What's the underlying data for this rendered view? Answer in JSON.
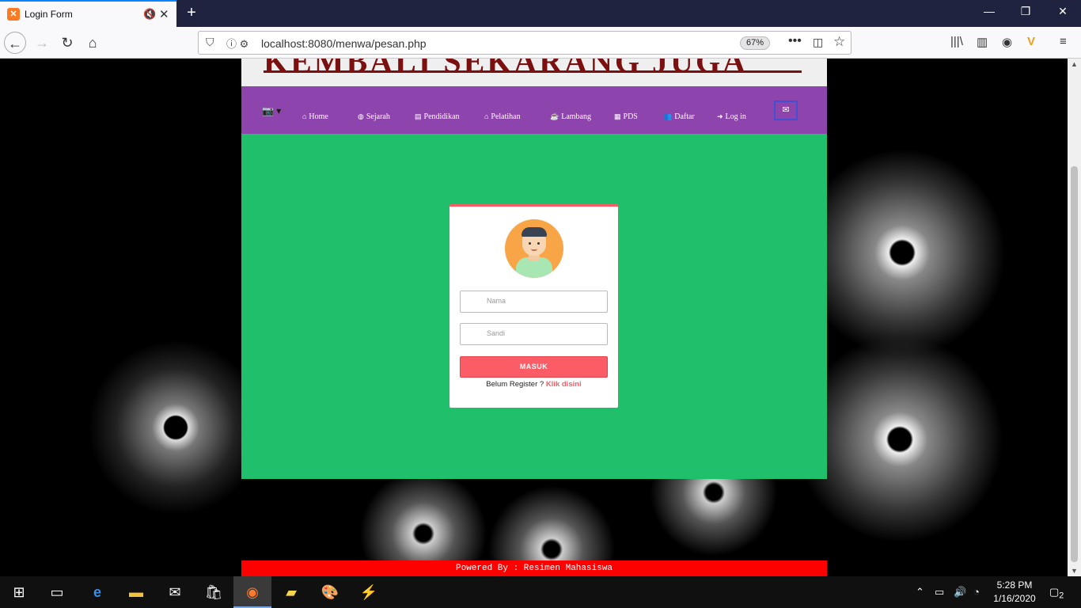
{
  "browser": {
    "tab_title": "Login Form",
    "url": "localhost:8080/menwa/pesan.php",
    "zoom": "67%"
  },
  "site": {
    "banner_text": "KEMBALI SEKARANG JUGA",
    "menu": [
      {
        "label": "Home",
        "icon": "home-icon"
      },
      {
        "label": "Sejarah",
        "icon": "globe-icon"
      },
      {
        "label": "Pendidikan",
        "icon": "book-icon"
      },
      {
        "label": "Pelatihan",
        "icon": "graduation-cap-icon"
      },
      {
        "label": "Lambang",
        "icon": "coffee-icon"
      },
      {
        "label": "PDS",
        "icon": "map-icon"
      },
      {
        "label": "Daftar",
        "icon": "users-icon"
      },
      {
        "label": "Log in",
        "icon": "sign-in-icon"
      }
    ],
    "colors": {
      "menu_bg": "#8e44ad",
      "content_bg": "#20bf6b",
      "accent": "#fc5c65",
      "footer_bg": "#ff0000"
    }
  },
  "login": {
    "name_placeholder": "Nama",
    "password_placeholder": "Sandi",
    "submit_label": "MASUK",
    "register_prompt": "Belum Register ?",
    "register_link": "Klik disini"
  },
  "footer": {
    "text": "Powered By : Resimen Mahasiswa"
  },
  "taskbar": {
    "time": "5:28 PM",
    "date": "1/16/2020",
    "notifications": "2"
  }
}
